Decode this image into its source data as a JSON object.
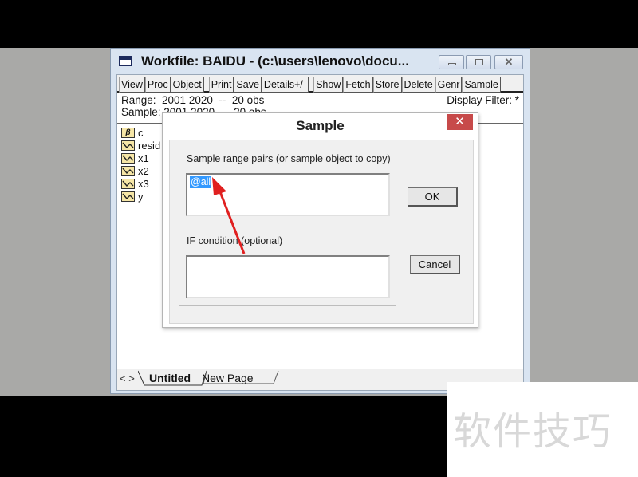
{
  "window": {
    "title": "Workfile: BAIDU - (c:\\users\\lenovo\\docu...",
    "controls": {
      "minimize": "minimize",
      "maximize": "maximize",
      "close": "close"
    }
  },
  "toolbar": {
    "buttons": [
      "View",
      "Proc",
      "Object",
      "Print",
      "Save",
      "Details+/-",
      "Show",
      "Fetch",
      "Store",
      "Delete",
      "Genr",
      "Sample"
    ]
  },
  "info": {
    "range": "Range:  2001 2020  --  20 obs",
    "sample": "Sample: 2001 2020  --  20 obs",
    "display_filter": "Display Filter: *"
  },
  "objects": [
    {
      "name": "c",
      "icon": "coefficient-icon"
    },
    {
      "name": "resid",
      "icon": "series-icon"
    },
    {
      "name": "x1",
      "icon": "series-icon"
    },
    {
      "name": "x2",
      "icon": "series-icon"
    },
    {
      "name": "x3",
      "icon": "series-icon"
    },
    {
      "name": "y",
      "icon": "series-icon"
    }
  ],
  "page_tabs": {
    "nav": "< >",
    "tabs": [
      "Untitled",
      "New Page"
    ],
    "active": "Untitled"
  },
  "dialog": {
    "title": "Sample",
    "close_glyph": "✕",
    "range_group_label": "Sample range pairs (or sample object to copy)",
    "range_value": "@all",
    "if_group_label": "IF condition (optional)",
    "if_value": "",
    "ok_label": "OK",
    "cancel_label": "Cancel"
  },
  "annotation": {
    "arrow_color": "#e02020"
  },
  "watermark": "软件技巧"
}
